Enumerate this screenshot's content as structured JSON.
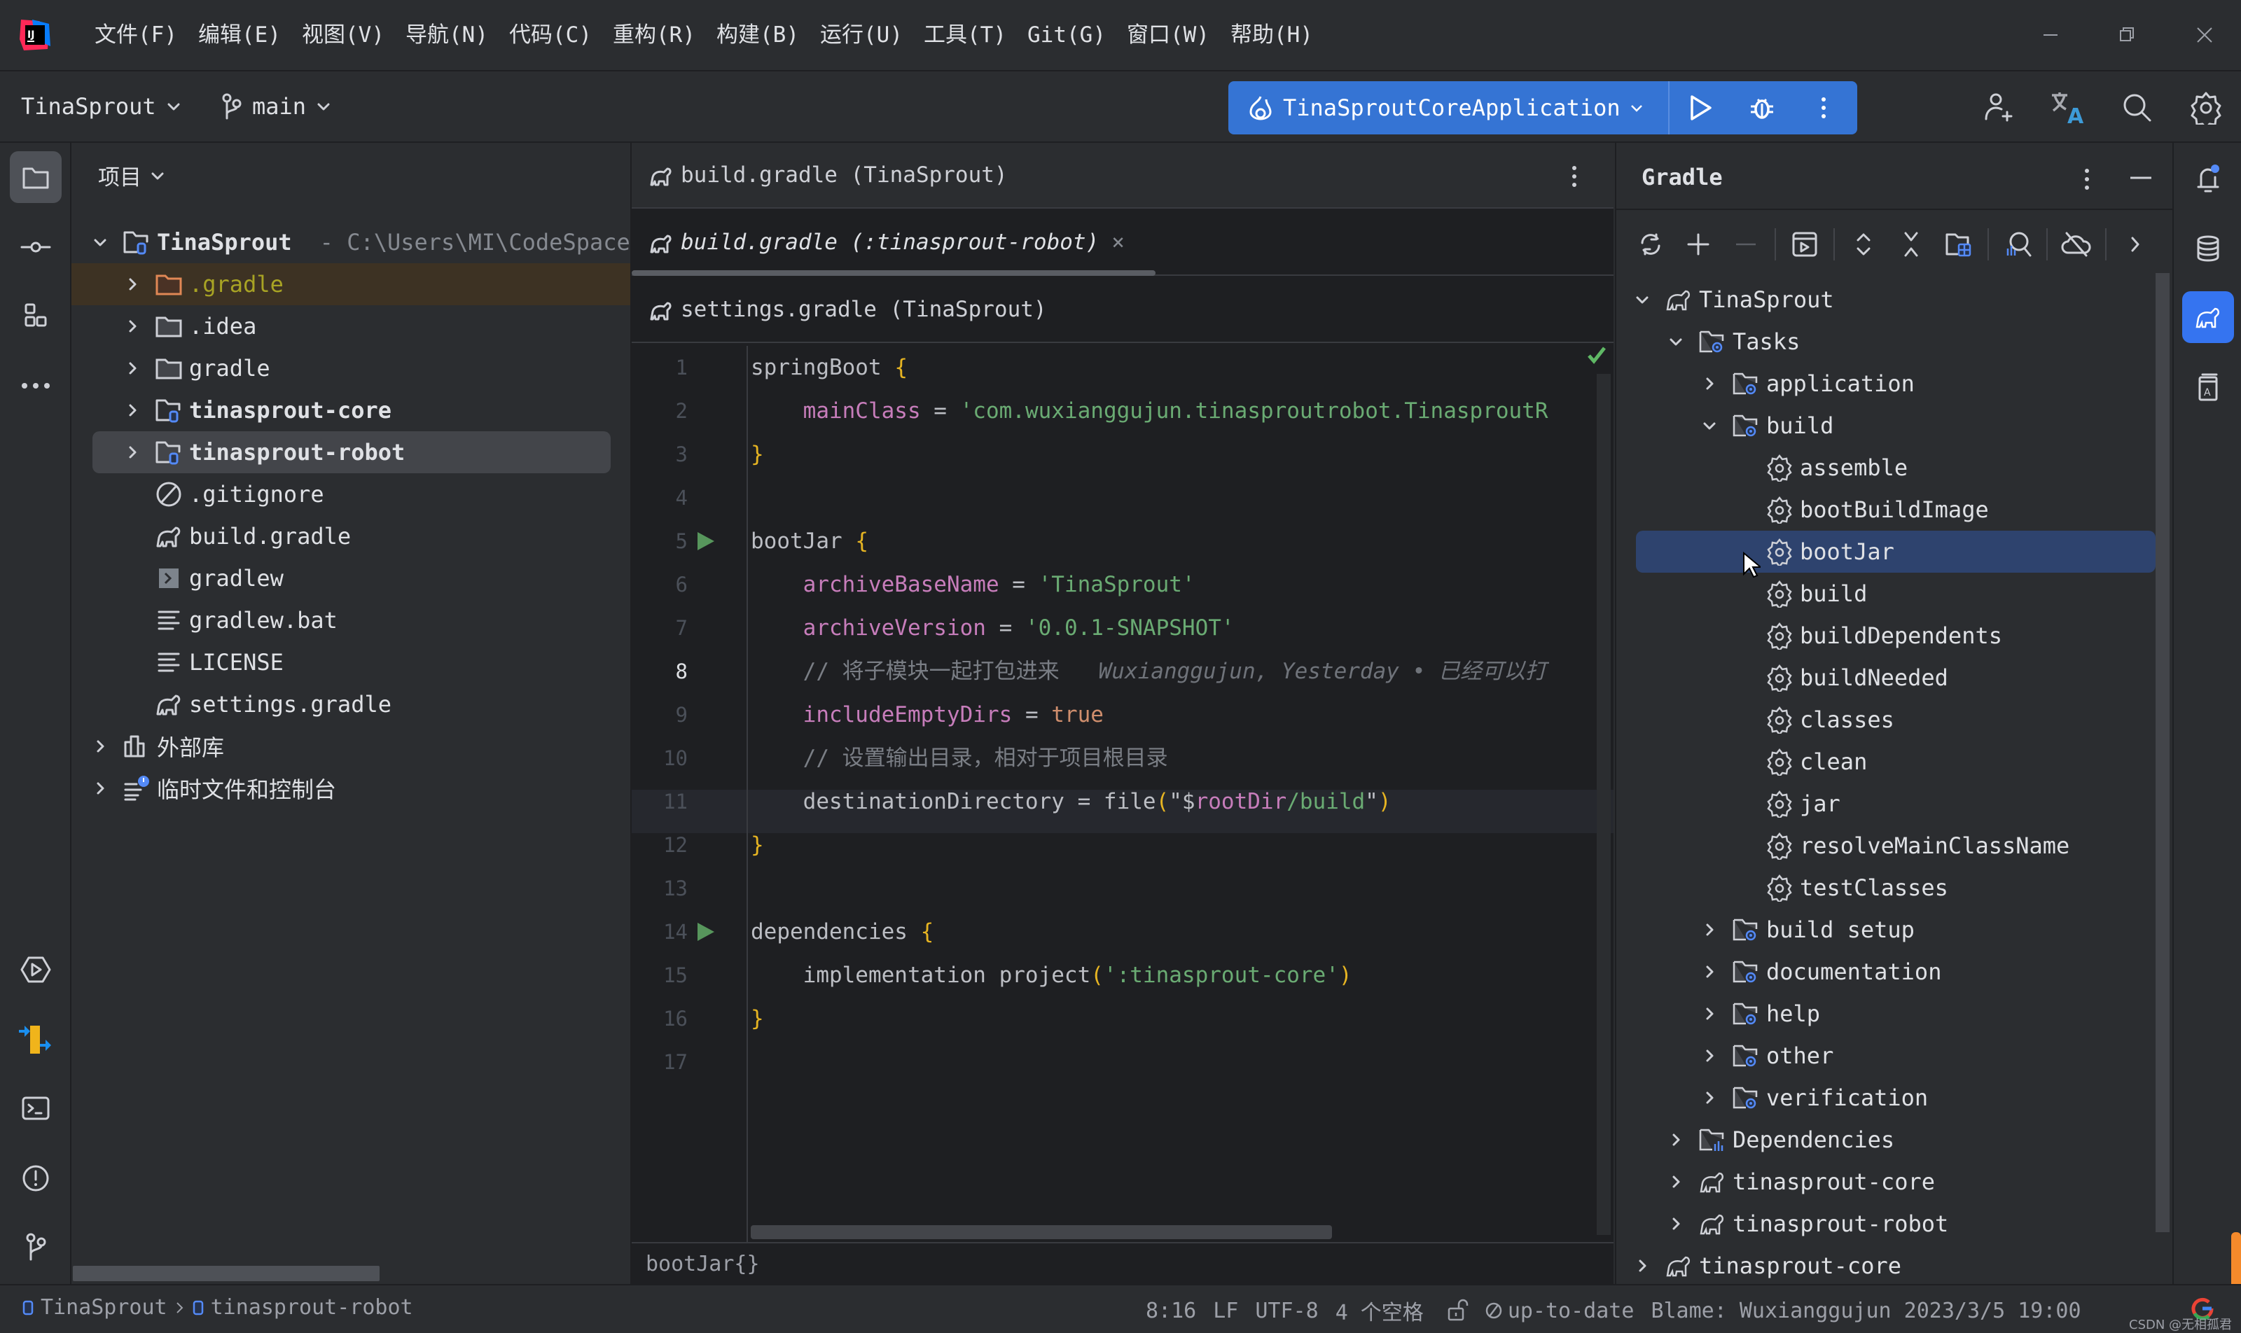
{
  "menubar": {
    "items": [
      "文件(F)",
      "编辑(E)",
      "视图(V)",
      "导航(N)",
      "代码(C)",
      "重构(R)",
      "构建(B)",
      "运行(U)",
      "工具(T)",
      "Git(G)",
      "窗口(W)",
      "帮助(H)"
    ]
  },
  "window_controls": {
    "minimize": "minimize-icon",
    "restore": "restore-icon",
    "close": "close-icon"
  },
  "toolbar": {
    "project_name": "TinaSprout",
    "branch": "main",
    "run_config": "TinaSproutCoreApplication",
    "run_widget_color": "#3574d4",
    "icons": [
      "add-user-icon",
      "translate-icon",
      "search-icon",
      "settings-gear-icon"
    ]
  },
  "left_strip": {
    "top": [
      "project-folder-icon",
      "commit-icon",
      "structure-icon",
      "more-icon"
    ],
    "bottom": [
      "services-run-icon",
      "plugin-icon",
      "terminal-icon",
      "problems-icon",
      "git-icon"
    ]
  },
  "project_panel": {
    "title": "项目",
    "root": {
      "name": "TinaSprout",
      "path": "- C:\\Users\\MI\\CodeSpace"
    },
    "items": [
      {
        "name": ".gradle",
        "type": "folder-excluded",
        "expandable": true
      },
      {
        "name": ".idea",
        "type": "folder",
        "expandable": true
      },
      {
        "name": "gradle",
        "type": "folder",
        "expandable": true
      },
      {
        "name": "tinasprout-core",
        "type": "module",
        "expandable": true
      },
      {
        "name": "tinasprout-robot",
        "type": "module",
        "expandable": true,
        "selected": true
      },
      {
        "name": ".gitignore",
        "type": "ignore-file"
      },
      {
        "name": "build.gradle",
        "type": "gradle-file"
      },
      {
        "name": "gradlew",
        "type": "shell-file"
      },
      {
        "name": "gradlew.bat",
        "type": "text-file"
      },
      {
        "name": "LICENSE",
        "type": "text-file"
      },
      {
        "name": "settings.gradle",
        "type": "gradle-file"
      }
    ],
    "external_libs": "外部库",
    "scratches": "临时文件和控制台"
  },
  "editor": {
    "tabs": [
      {
        "label": "build.gradle (TinaSprout)",
        "active": false
      },
      {
        "label": "build.gradle (:tinasprout-robot)",
        "active": true,
        "close": "×"
      },
      {
        "label": "settings.gradle (TinaSprout)",
        "active": false
      }
    ],
    "line_numbers": [
      "1",
      "2",
      "3",
      "4",
      "5",
      "6",
      "7",
      "8",
      "9",
      "10",
      "11",
      "12",
      "13",
      "14",
      "15",
      "16",
      "17"
    ],
    "lines": {
      "l1": {
        "a": "springBoot ",
        "b": "{"
      },
      "l2": {
        "a": "    ",
        "p": "mainClass",
        "e": " = ",
        "s": "'com.wuxianggujun.tinasproutrobot.TinasproutRobot"
      },
      "l3": {
        "b": "}"
      },
      "l5": {
        "a": "bootJar ",
        "b": "{"
      },
      "l6": {
        "a": "    ",
        "p": "archiveBaseName",
        "e": " = ",
        "s": "'TinaSprout'"
      },
      "l7": {
        "a": "    ",
        "p": "archiveVersion",
        "e": " = ",
        "s": "'0.0.1-SNAPSHOT'"
      },
      "l8": {
        "a": "    ",
        "c": "// 将子模块一起打包进来",
        "blame": "   Wuxianggujun, Yesterday • 已经可以打包了"
      },
      "l9": {
        "a": "    ",
        "p": "includeEmptyDirs",
        "e": " = ",
        "k": "true"
      },
      "l10": {
        "a": "    ",
        "c": "// 设置输出目录，相对于项目根目录"
      },
      "l11": {
        "a": "    destinationDirectory = file",
        "b1": "(",
        "q": "\"$",
        "p": "rootDir",
        "s": "/build",
        "q2": "\"",
        "b2": ")"
      },
      "l12": {
        "b": "}"
      },
      "l14": {
        "a": "dependencies ",
        "b": "{"
      },
      "l15": {
        "a": "    implementation project",
        "b1": "(",
        "s": "':tinasprout-core'",
        "b2": ")"
      },
      "l16": {
        "b": "}"
      }
    },
    "breadcrumb": "bootJar{}",
    "inspection_status": "ok"
  },
  "gradle_panel": {
    "title": "Gradle",
    "toolbar_icons": [
      "reload-icon",
      "add-icon",
      "remove-icon",
      "run-task-icon",
      "expand-all-icon",
      "collapse-all-icon",
      "group-modules-icon",
      "analyze-deps-icon",
      "offline-mode-icon",
      "more-chevron-icon"
    ],
    "tree": [
      {
        "label": "TinaSprout",
        "level": 0,
        "icon": "gradle",
        "expanded": true
      },
      {
        "label": "Tasks",
        "level": 1,
        "icon": "task-folder",
        "expanded": true
      },
      {
        "label": "application",
        "level": 2,
        "icon": "task-folder",
        "expanded": false
      },
      {
        "label": "build",
        "level": 2,
        "icon": "task-folder",
        "expanded": true
      },
      {
        "label": "assemble",
        "level": 3,
        "icon": "task"
      },
      {
        "label": "bootBuildImage",
        "level": 3,
        "icon": "task"
      },
      {
        "label": "bootJar",
        "level": 3,
        "icon": "task",
        "selected": true
      },
      {
        "label": "build",
        "level": 3,
        "icon": "task"
      },
      {
        "label": "buildDependents",
        "level": 3,
        "icon": "task"
      },
      {
        "label": "buildNeeded",
        "level": 3,
        "icon": "task"
      },
      {
        "label": "classes",
        "level": 3,
        "icon": "task"
      },
      {
        "label": "clean",
        "level": 3,
        "icon": "task"
      },
      {
        "label": "jar",
        "level": 3,
        "icon": "task"
      },
      {
        "label": "resolveMainClassName",
        "level": 3,
        "icon": "task"
      },
      {
        "label": "testClasses",
        "level": 3,
        "icon": "task"
      },
      {
        "label": "build setup",
        "level": 2,
        "icon": "task-folder",
        "expanded": false
      },
      {
        "label": "documentation",
        "level": 2,
        "icon": "task-folder",
        "expanded": false
      },
      {
        "label": "help",
        "level": 2,
        "icon": "task-folder",
        "expanded": false
      },
      {
        "label": "other",
        "level": 2,
        "icon": "task-folder",
        "expanded": false
      },
      {
        "label": "verification",
        "level": 2,
        "icon": "task-folder",
        "expanded": false
      },
      {
        "label": "Dependencies",
        "level": 1,
        "icon": "deps-folder",
        "expanded": false
      },
      {
        "label": "tinasprout-core",
        "level": 1,
        "icon": "gradle",
        "expanded": false
      },
      {
        "label": "tinasprout-robot",
        "level": 1,
        "icon": "gradle",
        "expanded": false
      },
      {
        "label": "tinasprout-core",
        "level": 0,
        "icon": "gradle",
        "expanded": false
      }
    ]
  },
  "right_strip": [
    "notifications-icon",
    "database-icon",
    "gradle-icon",
    "translate-dict-icon"
  ],
  "statusbar": {
    "path": [
      "TinaSprout",
      "tinasprout-robot"
    ],
    "position": "8:16",
    "line_sep": "LF",
    "encoding": "UTF-8",
    "indent": "4 个空格",
    "vcs_status": "up-to-date",
    "blame": "Blame: Wuxianggujun 2023/3/5 19:00",
    "watermark": "CSDN @无相孤君"
  }
}
